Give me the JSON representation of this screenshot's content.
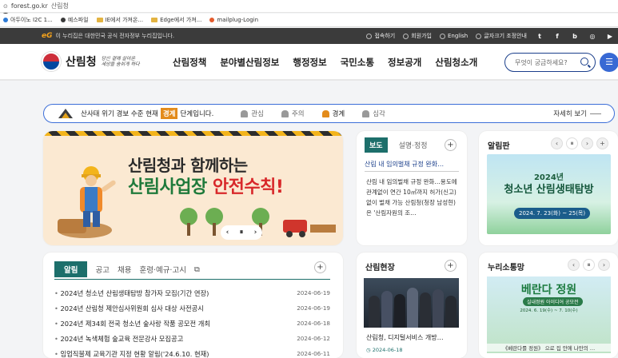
{
  "browser": {
    "url": "forest.go.kr",
    "site_title": "산림청",
    "bookmarks": [
      {
        "label": "아두이노 I2C 1...",
        "color": "#2e7bd6",
        "type": "dot"
      },
      {
        "label": "예스파일",
        "color": "#3a3a3a",
        "type": "dot"
      },
      {
        "label": "IE에서 가져온...",
        "color": "#e3b341",
        "type": "folder"
      },
      {
        "label": "Edge에서 가져...",
        "color": "#e3b341",
        "type": "folder"
      },
      {
        "label": "mailplug-Login",
        "color": "#e45b2d",
        "type": "dot"
      }
    ]
  },
  "govbar": {
    "logo": "eG",
    "text": "이 누리집은 대한민국 공식 전자정부 누리집입니다.",
    "links": [
      "접속하기",
      "회원가입",
      "English",
      "글자크기 조정안내"
    ],
    "social": [
      "t",
      "f",
      "b",
      "◎",
      "▶"
    ]
  },
  "header": {
    "logo_name": "산림청",
    "slogan_1": "당신 곁에 살아온",
    "slogan_2": "세상을 숨쉬게 하다",
    "nav": [
      "산림정책",
      "분야별산림정보",
      "행정정보",
      "국민소통",
      "정보공개",
      "산림청소개"
    ],
    "search_placeholder": "무엇이 궁금하세요?",
    "menu_icon": "☰"
  },
  "alert": {
    "prefix": "산사태 위기 경보 수준 현재",
    "level": "경계",
    "suffix": "단계입니다.",
    "levels": [
      "관심",
      "주의",
      "경계",
      "심각"
    ],
    "active_level": "경계",
    "more": "자세히 보기",
    "accent": "#e38b1b"
  },
  "banner": {
    "line1": "산림청과 함께하는",
    "line2_green": "산림사업장",
    "line2_red": "안전수칙!",
    "prev": "‹",
    "pause": "⏸",
    "next": "›"
  },
  "news": {
    "tabs": [
      "보도",
      "설명·정정"
    ],
    "active_tab": "보도",
    "plus": "+",
    "headline": "산림 내 임의벌채 규정 완화…",
    "body": "산림 내 임의벌채 규정 완화…용도에 관계없이 연간 10㎥까지 허가(신고)없이 벌채 가능 산림청(청장 남성현)은 '산림자원의 조…",
    "date": "2024-06-19"
  },
  "notice_board": {
    "title": "알림판",
    "prev": "‹",
    "pause": "⏸",
    "next": "›",
    "poster_year": "2024년",
    "poster_title": "청소년 산림생태탐방",
    "poster_date": "2024. 7. 23(화) ~ 25(목)"
  },
  "notices": {
    "tabs": [
      "알림",
      "공고",
      "채용",
      "훈령·예규·고시"
    ],
    "active_tab": "알림",
    "plus": "+",
    "items": [
      {
        "title": "2024년 청소년 산림생태탐방 참가자 모집(기간 연장)",
        "date": "2024-06-19"
      },
      {
        "title": "2024년 산림청 제안심사위원회 심사 대상 사전공시",
        "date": "2024-06-19"
      },
      {
        "title": "2024년 제34회 전국 청소년 숲사랑 작품 공모전 개최",
        "date": "2024-06-18"
      },
      {
        "title": "2024년 녹색체험 숲교육 전문강사 모집공고",
        "date": "2024-06-12"
      },
      {
        "title": "임업직불제 교육기관 지정 현황 알림('24.6.10. 현재)",
        "date": "2024-06-11"
      }
    ]
  },
  "field": {
    "title": "산림현장",
    "plus": "+",
    "caption": "산림청, 디지털서비스 개방…",
    "date": "2024-06-18"
  },
  "sns": {
    "title": "누리소통망",
    "prev": "‹",
    "pause": "⏸",
    "next": "›",
    "poster_title": "베란다 정원",
    "poster_sub": "실내정원 아이디어 공모전",
    "poster_date": "2024. 6. 19(수) ~ 7. 10(수)",
    "poster_caption": "《베란다를 정원》 으로 집 안에 나만의 …"
  }
}
